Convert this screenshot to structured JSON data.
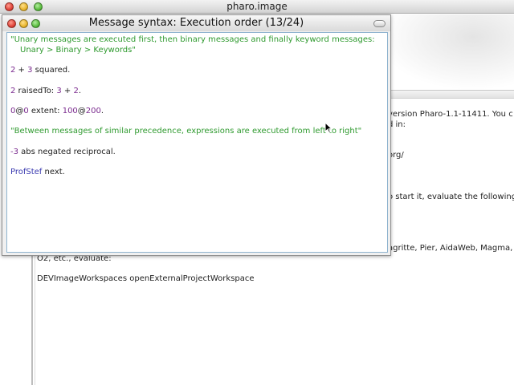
{
  "os_window": {
    "title": "pharo.image"
  },
  "background_workspace": {
    "lines": [
      "version Pharo-1.1-11411. You c",
      "d in:",
      "org/",
      "o start it, evaluate the following",
      "agritte, Pier, AidaWeb, Magma, M",
      "O2, etc., evaluate:",
      "DEVImageWorkspaces openExternalProjectWorkspace"
    ]
  },
  "message_window": {
    "title": "Message syntax: Execution order (13/24)",
    "code": {
      "comment1_line1": "\"Unary messages are executed first, then binary messages and finally keyword messages:",
      "comment1_line2": "Unary > Binary > Keywords\"",
      "expr1": {
        "n1": "2",
        "op": " + ",
        "n2": "3",
        "rest": " squared."
      },
      "expr2": {
        "n1": "2",
        "kw": " raisedTo: ",
        "n2": "3",
        "op": " + ",
        "n3": "2",
        "rest": "."
      },
      "expr3": {
        "n1": "0",
        "at1": "@",
        "n2": "0",
        "kw": " extent: ",
        "n3": "100",
        "at2": "@",
        "n4": "200",
        "rest": "."
      },
      "comment2": "\"Between messages of similar precedence, expressions are executed from left to right\"",
      "expr4": {
        "n1": "-3",
        "rest": " abs negated reciprocal."
      },
      "expr5": {
        "cls": "ProfStef",
        "rest": " next."
      }
    }
  },
  "colors": {
    "comment": "#2f9a2f",
    "number": "#7a2a8e",
    "class": "#3a3ab0"
  }
}
